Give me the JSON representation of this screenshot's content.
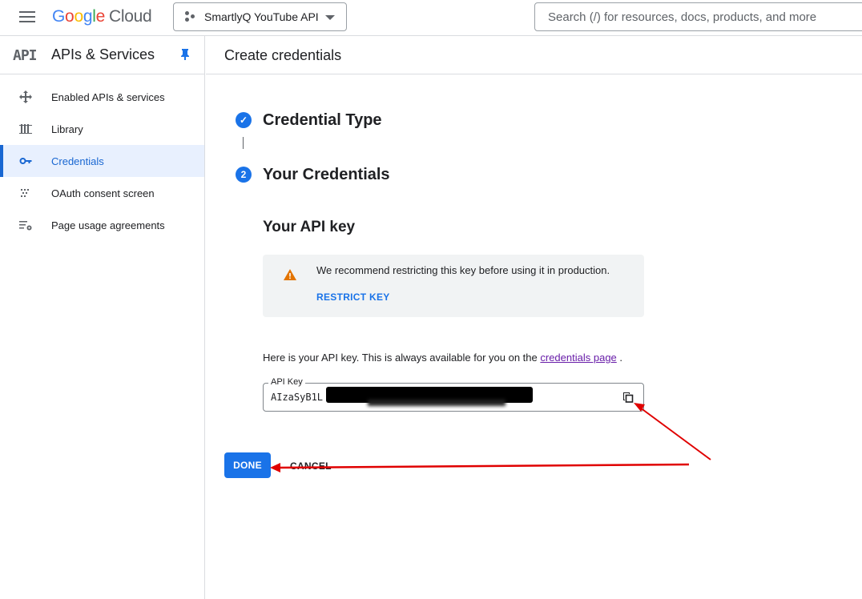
{
  "topbar": {
    "logo_google": [
      "G",
      "o",
      "o",
      "g",
      "l",
      "e"
    ],
    "logo_product": "Cloud",
    "project_name": "SmartlyQ YouTube API",
    "search_placeholder": "Search (/) for resources, docs, products, and more"
  },
  "sidebar": {
    "mark": "API",
    "title": "APIs & Services",
    "items": [
      {
        "label": "Enabled APIs & services",
        "icon": "move-icon"
      },
      {
        "label": "Library",
        "icon": "library-icon"
      },
      {
        "label": "Credentials",
        "icon": "key-icon",
        "active": true
      },
      {
        "label": "OAuth consent screen",
        "icon": "consent-icon"
      },
      {
        "label": "Page usage agreements",
        "icon": "settings-list-icon"
      }
    ]
  },
  "main": {
    "title": "Create credentials",
    "steps": [
      {
        "number": "✓",
        "title": "Credential Type"
      },
      {
        "number": "2",
        "title": "Your Credentials"
      }
    ],
    "subhead": "Your API key",
    "warning": {
      "text": "We recommend restricting this key before using it in production.",
      "action": "RESTRICT KEY"
    },
    "info_text": "Here is your API key. This is always available for you on the",
    "info_link": "credentials page",
    "info_end": ".",
    "api_key": {
      "label": "API Key",
      "value_visible": "AIzaSyB1L"
    },
    "done_label": "DONE",
    "cancel_label": "CANCEL"
  },
  "colors": {
    "accent": "#1a73e8",
    "active_bg": "#e8f0fe",
    "warning": "#e37400",
    "annotation": "#e00000"
  }
}
